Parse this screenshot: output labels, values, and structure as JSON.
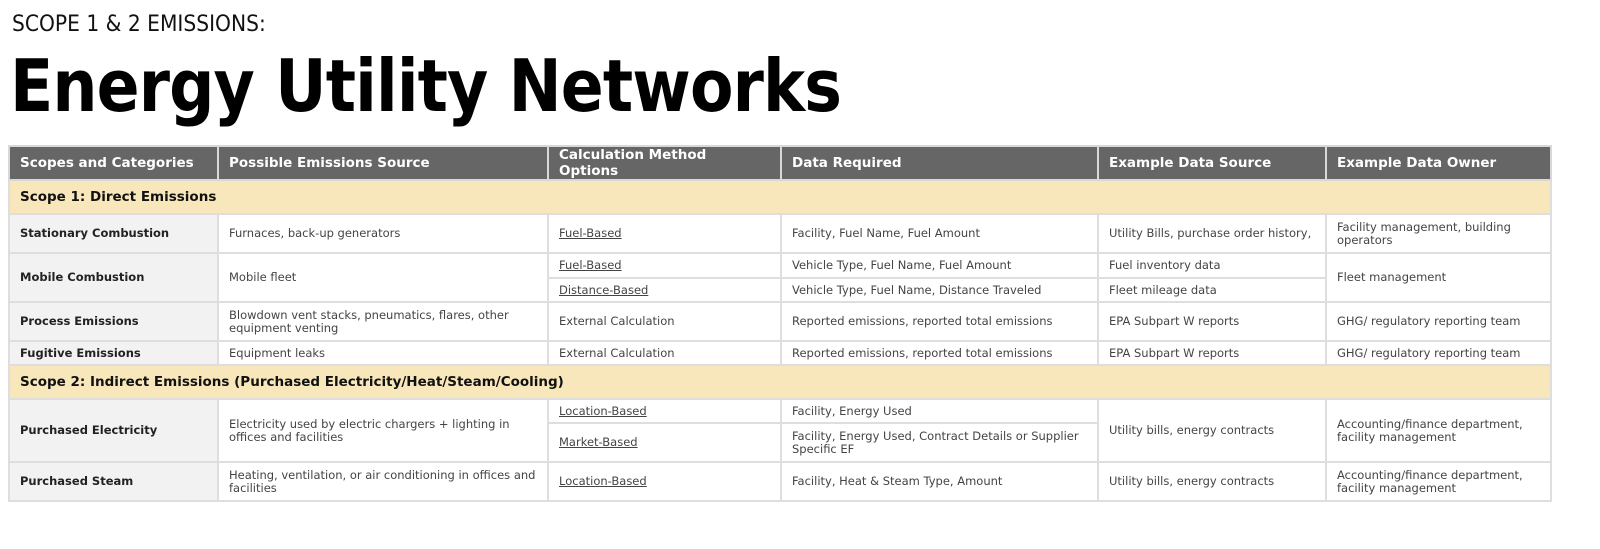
{
  "header": {
    "eyebrow": "SCOPE 1 & 2 EMISSIONS:",
    "title": "Energy Utility Networks"
  },
  "colors": {
    "header_bg": "#666666",
    "scope_row_bg": "#f8e7bb",
    "category_bg": "#f2f2f2",
    "border": "#dedede"
  },
  "table": {
    "columns": [
      "Scopes and Categories",
      "Possible Emissions Source",
      "Calculation Method Options",
      "Data Required",
      "Example Data Source",
      "Example Data Owner"
    ],
    "scope1": {
      "label": "Scope 1: Direct Emissions",
      "rows": {
        "stationary": {
          "category": "Stationary Combustion",
          "source": "Furnaces, back-up generators",
          "method": "Fuel-Based",
          "data_required": "Facility, Fuel Name, Fuel Amount",
          "data_source": "Utility Bills, purchase order history,",
          "data_owner": "Facility management, building operators"
        },
        "mobile": {
          "category": "Mobile Combustion",
          "source": "Mobile fleet",
          "methods": [
            {
              "method": "Fuel-Based",
              "data_required": "Vehicle Type, Fuel Name, Fuel Amount",
              "data_source": "Fuel inventory data"
            },
            {
              "method": "Distance-Based",
              "data_required": "Vehicle Type, Fuel Name, Distance Traveled",
              "data_source": "Fleet mileage data"
            }
          ],
          "data_owner": "Fleet management"
        },
        "process": {
          "category": "Process Emissions",
          "source": "Blowdown vent stacks, pneumatics, flares, other equipment venting",
          "method": "External Calculation",
          "data_required": "Reported emissions, reported total emissions",
          "data_source": "EPA Subpart W reports",
          "data_owner": "GHG/ regulatory reporting team"
        },
        "fugitive": {
          "category": "Fugitive Emissions",
          "source": "Equipment leaks",
          "method": "External Calculation",
          "data_required": "Reported emissions, reported total emissions",
          "data_source": "EPA Subpart W reports",
          "data_owner": "GHG/ regulatory reporting team"
        }
      }
    },
    "scope2": {
      "label": "Scope 2: Indirect Emissions (Purchased Electricity/Heat/Steam/Cooling)",
      "rows": {
        "electricity": {
          "category": "Purchased Electricity",
          "source": "Electricity used by electric chargers + lighting in offices and facilities",
          "methods": [
            {
              "method": "Location-Based",
              "data_required": "Facility, Energy Used"
            },
            {
              "method": "Market-Based",
              "data_required": "Facility, Energy Used, Contract Details or Supplier Specific EF"
            }
          ],
          "data_source": "Utility bills, energy contracts",
          "data_owner": "Accounting/finance department, facility management"
        },
        "steam": {
          "category": "Purchased Steam",
          "source": "Heating, ventilation, or air conditioning in offices and facilities",
          "method": "Location-Based",
          "data_required": "Facility, Heat & Steam Type, Amount",
          "data_source": "Utility bills, energy contracts",
          "data_owner": "Accounting/finance department, facility management"
        }
      }
    }
  }
}
